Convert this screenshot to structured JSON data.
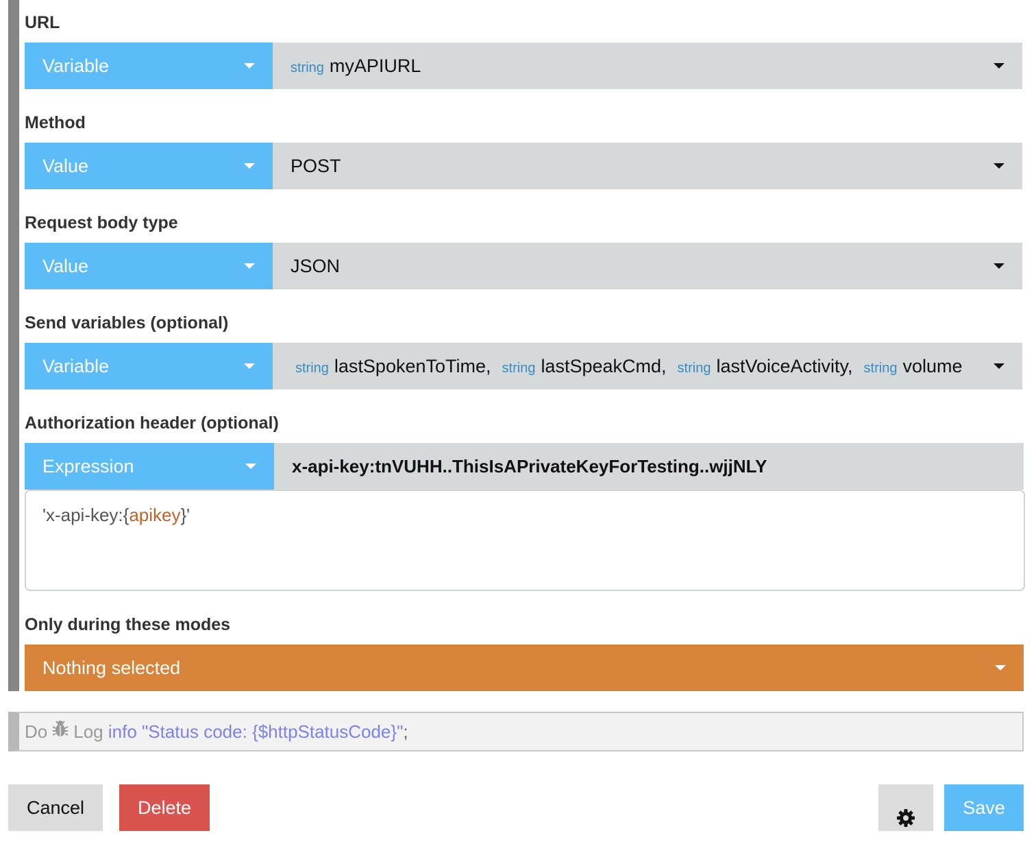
{
  "url": {
    "label": "URL",
    "type": "Variable",
    "value_type": "string",
    "value": "myAPIURL"
  },
  "method": {
    "label": "Method",
    "type": "Value",
    "value": "POST"
  },
  "body_type": {
    "label": "Request body type",
    "type": "Value",
    "value": "JSON"
  },
  "send_variables": {
    "label": "Send variables (optional)",
    "type": "Variable",
    "items": [
      {
        "type": "string",
        "name": "lastSpokenToTime",
        "sep": ","
      },
      {
        "type": "string",
        "name": "lastSpeakCmd",
        "sep": ","
      },
      {
        "type": "string",
        "name": "lastVoiceActivity",
        "sep": ","
      },
      {
        "type": "string",
        "name": "volume",
        "sep": ""
      }
    ]
  },
  "auth_header": {
    "label": "Authorization header (optional)",
    "type": "Expression",
    "evaluated": "x-api-key:tnVUHH..ThisIsAPrivateKeyForTesting..wjjNLY",
    "expression_prefix": "'x-api-key:{",
    "expression_var": "apikey",
    "expression_suffix": "}'"
  },
  "modes": {
    "label": "Only during these modes",
    "value": "Nothing selected"
  },
  "statement": {
    "do": "Do",
    "log": "Log",
    "level": "info",
    "message": "\"Status code: {$httpStatusCode}\"",
    "end": ";"
  },
  "buttons": {
    "cancel": "Cancel",
    "delete": "Delete",
    "save": "Save"
  },
  "colors": {
    "accent_blue": "#5bbcf7",
    "modes_orange": "#d7843a",
    "delete_red": "#d9534f",
    "keyword_purple": "#7d82e8",
    "type_tag_blue": "#3a8bbd",
    "expr_var_orange": "#c0632a"
  },
  "icons": {
    "statement": "bug-icon",
    "settings": "gear-icon"
  }
}
